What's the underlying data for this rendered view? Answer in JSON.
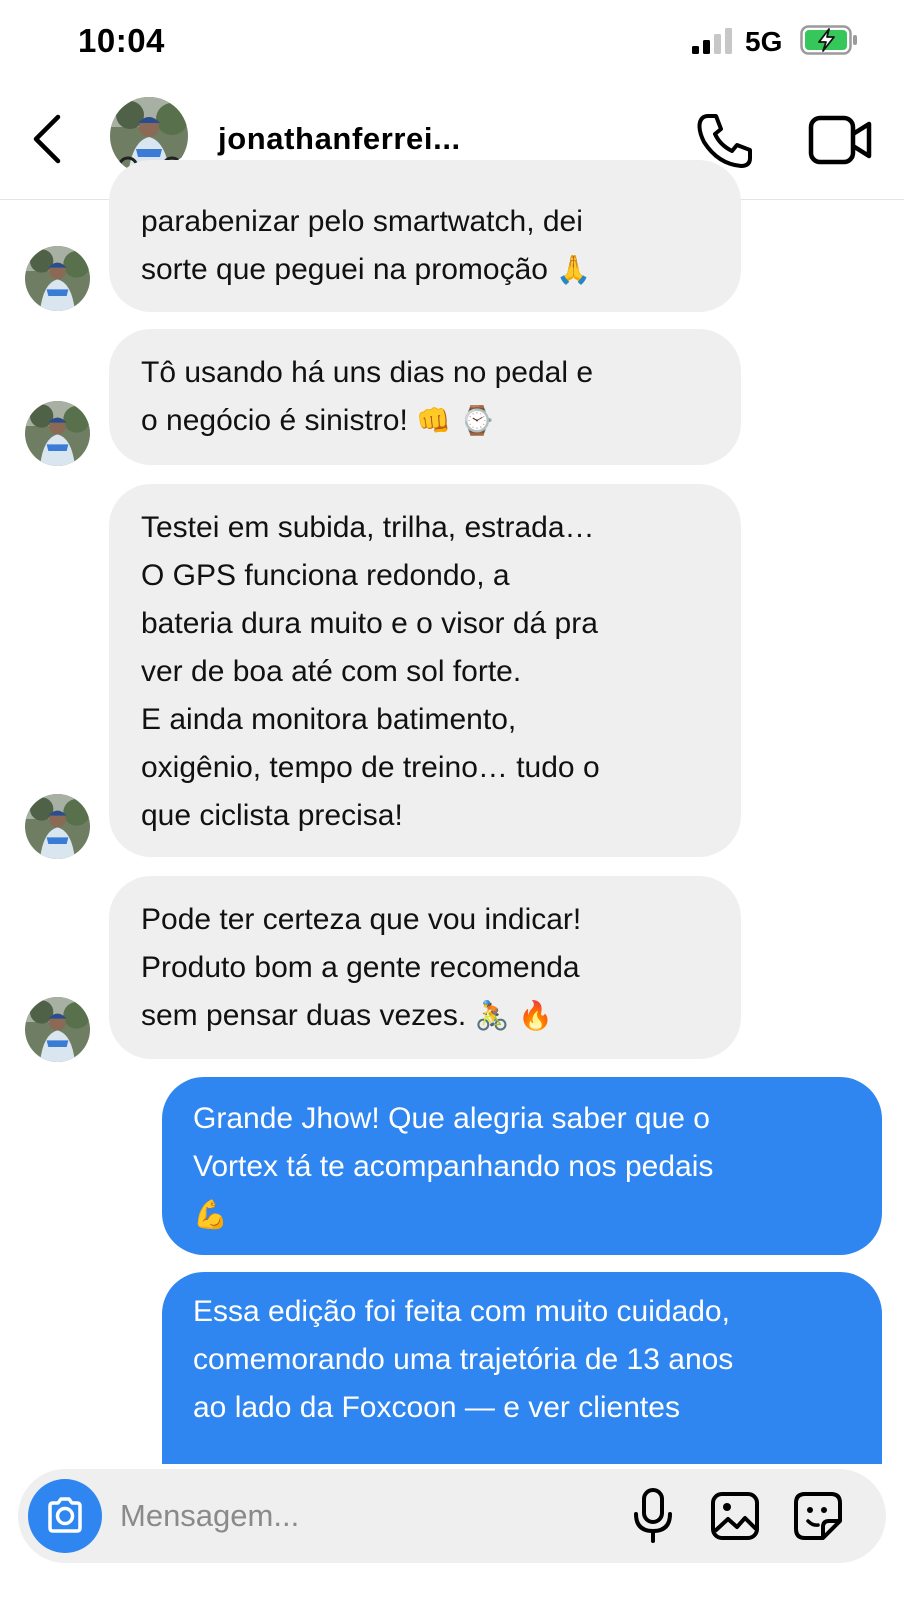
{
  "status_bar": {
    "time": "10:04",
    "network": "5G",
    "icons": [
      "signal-icon",
      "battery-charging-icon"
    ]
  },
  "header": {
    "contact_name": "jonathanferrei...",
    "online": true,
    "icons": [
      "back-arrow-icon",
      "phone-icon",
      "video-camera-icon"
    ]
  },
  "messages": [
    {
      "direction": "incoming",
      "text": "parabenizar pelo smartwatch, dei\nsorte que peguei na promoção ",
      "emoji": "🙏"
    },
    {
      "direction": "incoming",
      "text": "Tô usando há uns dias no pedal e\no negócio é sinistro! ",
      "emoji": "👊 ⌚"
    },
    {
      "direction": "incoming",
      "text": "Testei em subida, trilha, estrada…\nO GPS funciona redondo, a\nbateria dura muito e o visor dá pra\nver de boa até com sol forte.\nE ainda monitora batimento,\noxigênio, tempo de treino… tudo o\nque ciclista precisa!",
      "emoji": ""
    },
    {
      "direction": "incoming",
      "text": "Pode ter certeza que vou indicar!\nProduto bom a gente recomenda\nsem pensar duas vezes. ",
      "emoji": "🚴 🔥"
    },
    {
      "direction": "outgoing",
      "text": "Grande Jhow! Que alegria saber que o\nVortex tá te acompanhando nos pedais\n",
      "emoji": "💪"
    },
    {
      "direction": "outgoing",
      "text": "Essa edição foi feita com muito cuidado,\ncomemorando uma trajetória de 13 anos\nao lado da Foxcoon — e ver clientes",
      "emoji": ""
    }
  ],
  "composer": {
    "placeholder": "Mensagem...",
    "icons": [
      "camera-icon",
      "microphone-icon",
      "gallery-icon",
      "sticker-icon"
    ]
  },
  "colors": {
    "outgoing_bubble": "#2f86f1",
    "incoming_bubble": "#efefef",
    "online_dot": "#3ec13a",
    "battery_fill": "#35c759"
  }
}
